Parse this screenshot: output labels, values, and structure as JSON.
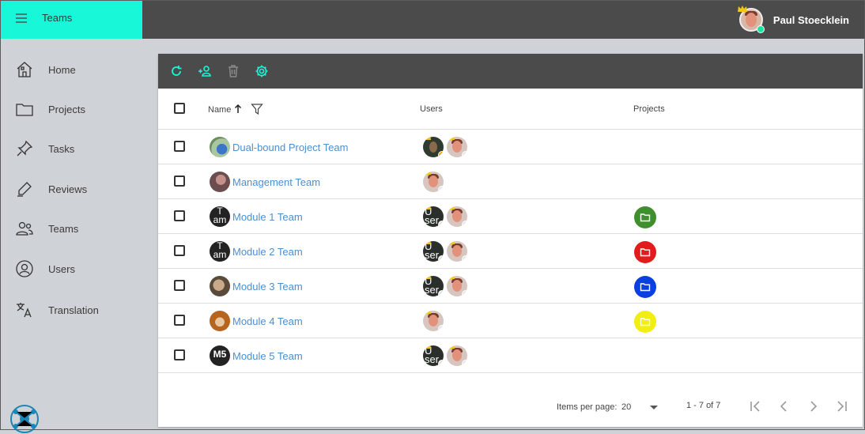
{
  "header": {
    "app_title": "Teams",
    "user_name": "Paul Stoecklein",
    "menu_icon": "hamburger-menu-icon",
    "accent_color": "#19f7d9",
    "bar_color": "#4b4b4b"
  },
  "sidebar": {
    "items": [
      {
        "label": "Home",
        "icon": "home-icon"
      },
      {
        "label": "Projects",
        "icon": "folder-icon"
      },
      {
        "label": "Tasks",
        "icon": "pin-icon"
      },
      {
        "label": "Reviews",
        "icon": "pen-icon"
      },
      {
        "label": "Teams",
        "icon": "people-icon"
      },
      {
        "label": "Users",
        "icon": "user-circle-icon"
      },
      {
        "label": "Translation",
        "icon": "translate-icon"
      }
    ],
    "logo_icon": "app-logo-icon"
  },
  "toolbar": {
    "buttons": [
      "refresh-icon",
      "add-user-icon",
      "delete-icon",
      "settings-icon"
    ]
  },
  "table": {
    "columns": {
      "name": "Name",
      "users": "Users",
      "projects": "Projects"
    },
    "sort": "ascending",
    "rows": [
      {
        "name": "Dual-bound Project Team",
        "avatar_text": "",
        "users": [
          "photo-dark-owner",
          "photo-owner"
        ],
        "project_color": null
      },
      {
        "name": "Management Team",
        "avatar_text": "",
        "users": [
          "photo-owner"
        ],
        "project_color": null
      },
      {
        "name": "Module 1 Team",
        "avatar_text": "T\nam",
        "users": [
          "broken-owner",
          "photo-owner"
        ],
        "project_color": "#3f8f2f"
      },
      {
        "name": "Module 2 Team",
        "avatar_text": "T\nam",
        "users": [
          "broken-owner",
          "photo-owner"
        ],
        "project_color": "#e31b1b"
      },
      {
        "name": "Module 3 Team",
        "avatar_text": "",
        "users": [
          "broken-owner",
          "photo-owner"
        ],
        "project_color": "#0a3fe0"
      },
      {
        "name": "Module 4 Team",
        "avatar_text": "",
        "users": [
          "photo-owner"
        ],
        "project_color": "#f2ee12"
      },
      {
        "name": "Module 5 Team",
        "avatar_text": "M5",
        "users": [
          "broken-owner",
          "photo-owner"
        ],
        "project_color": null
      }
    ],
    "broken_user_text": "U\nser"
  },
  "paginator": {
    "items_per_page_label": "Items per page:",
    "page_size": "20",
    "range_label": "1 - 7 of 7"
  }
}
